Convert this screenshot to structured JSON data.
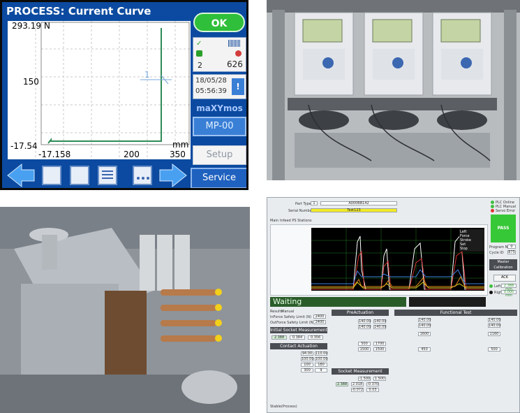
{
  "hmi": {
    "title": "PROCESS: Current Curve",
    "y_top": "293.19",
    "y_unit": "N",
    "y_mid": "150",
    "y_bottom": "-17.54",
    "x_left": "-17.158",
    "x_mid": "200",
    "x_right": "350",
    "x_unit": "mm",
    "cursor_label": "1",
    "ok_label": "OK",
    "count_a": "2",
    "count_b": "626",
    "date": "18/05/28",
    "time": "05:56:39",
    "brand": "maXYmos",
    "program": "MP-00",
    "setup_label": "Setup",
    "service_label": "Service",
    "plot_color": "#2e8b57"
  },
  "software": {
    "part_type_label": "Part Type",
    "part_type_index": "1",
    "part_type_value": "A000BB142",
    "serial_label": "Serial Number",
    "serial_value": "Test123",
    "serial_color": "#f2ea25",
    "tabs": [
      "Main",
      "Infeed PS Stations"
    ],
    "status_led_labels": [
      "PLC Online",
      "PLC Manual",
      "Servo Error"
    ],
    "pass_label": "PASS",
    "pass_color": "#37c837",
    "program_no_label": "Program No.",
    "program_no_value": "0",
    "cycle_label": "Cycle ID",
    "cycle_value": "875",
    "master_cal_label": "Master Calibration",
    "ack_label": "ACK",
    "cal_rows": [
      {
        "label": "Left",
        "value": "2.388 mm"
      },
      {
        "label": "Right",
        "value": "0.000 mm"
      }
    ],
    "waiting": "Waiting",
    "chart_legend": [
      "Left",
      "Force",
      "Stroke",
      "Set",
      "Slop"
    ],
    "result_tabs": [
      "Results",
      "Manual"
    ],
    "safety_rows": [
      {
        "label": "InForce Safety Limit (N)",
        "value": "2400"
      },
      {
        "label": "OutForce Safety Limit (N)",
        "value": "2400"
      }
    ],
    "sections": {
      "initial": "Initial Socket Measurement",
      "contact": "Contact Actuation",
      "preact": "PreActuation",
      "socket": "Socket Measurement",
      "functional": "Functional Test"
    },
    "init_values": [
      "2.388",
      "0.384",
      "0.356"
    ],
    "contact_values": [
      "94.00",
      "110.00",
      "100.00",
      "100.00",
      "100",
      "180",
      "300",
      "9"
    ],
    "preact_values": [
      "140.00",
      "140.00",
      "140.00",
      "140.00",
      "500",
      "1700",
      "1500",
      "1500"
    ],
    "socket_values": [
      "-1.500",
      "1.500",
      "2.388",
      "2.018",
      "-0.370",
      "-0.072",
      "0.03"
    ],
    "func_values": [
      "140.00",
      "140.00",
      "140.00",
      "140.00",
      "1600",
      "1160",
      "450",
      "500"
    ],
    "footer": "Stable(Process)"
  }
}
